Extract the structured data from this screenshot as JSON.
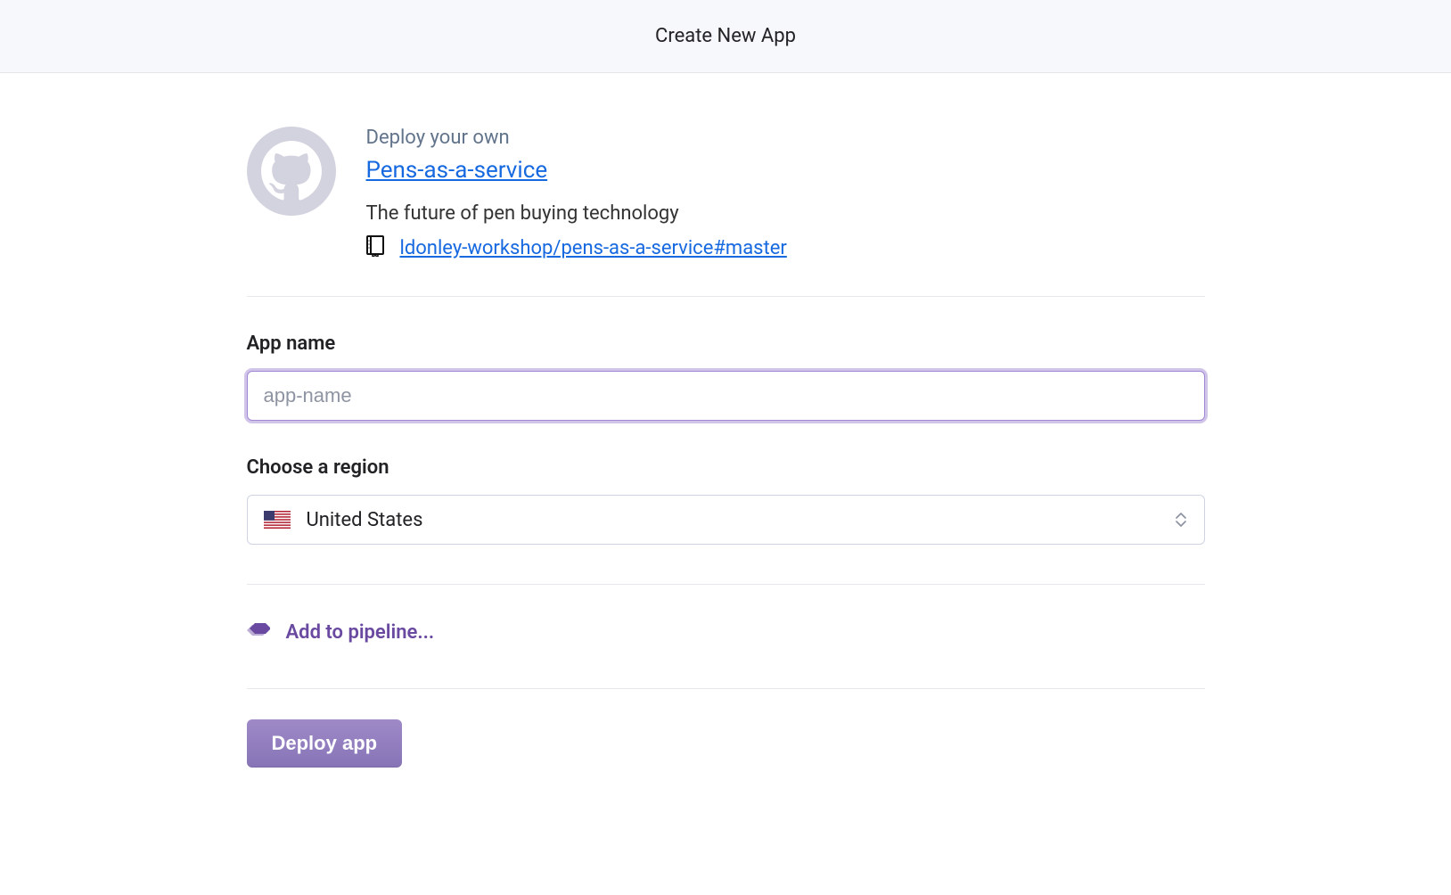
{
  "header": {
    "title": "Create New App"
  },
  "repo": {
    "deploy_label": "Deploy your own",
    "name": "Pens-as-a-service",
    "description": "The future of pen buying technology",
    "source": "ldonley-workshop/pens-as-a-service#master"
  },
  "form": {
    "app_name_label": "App name",
    "app_name_placeholder": "app-name",
    "app_name_value": "",
    "region_label": "Choose a region",
    "region_selected": "United States"
  },
  "pipeline": {
    "label": "Add to pipeline..."
  },
  "actions": {
    "deploy_label": "Deploy app"
  },
  "colors": {
    "link": "#1769e0",
    "accent": "#6a4aa0",
    "header_bg": "#f7f8fb",
    "border": "#e6e6eb"
  }
}
